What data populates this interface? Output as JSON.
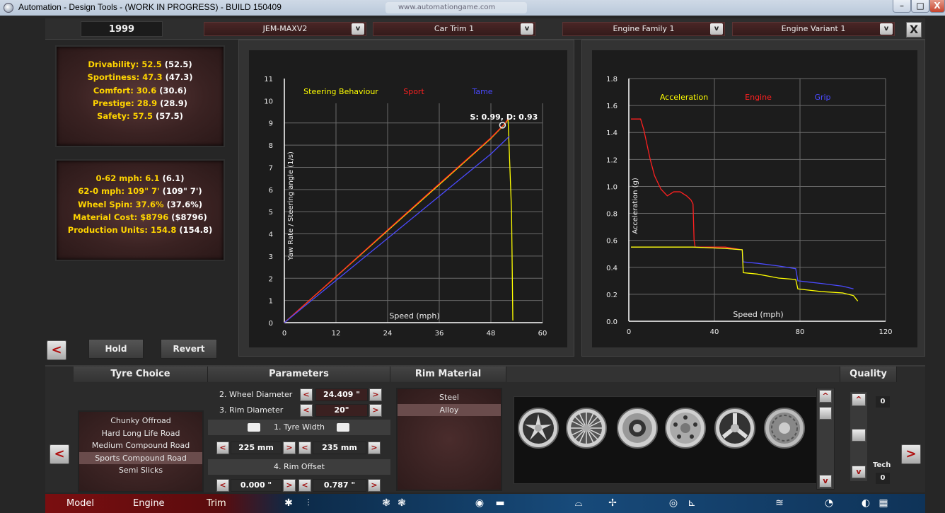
{
  "window": {
    "title": "Automation - Design Tools - (WORK IN PROGRESS) - BUILD 150409",
    "ghost_tab": "www.automationgame.com",
    "min_label": "–",
    "max_label": "□",
    "close_label": "X"
  },
  "topbar": {
    "year": "1999",
    "model": "JEM-MAXV2",
    "trim": "Car Trim 1",
    "engine_family": "Engine Family 1",
    "engine_variant": "Engine Variant 1",
    "arrow": "v",
    "close": "X"
  },
  "stats1": [
    {
      "label": "Drivability: 52.5",
      "paren": "(52.5)"
    },
    {
      "label": "Sportiness: 47.3",
      "paren": "(47.3)"
    },
    {
      "label": "Comfort: 30.6",
      "paren": "(30.6)"
    },
    {
      "label": "Prestige: 28.9",
      "paren": "(28.9)"
    },
    {
      "label": "Safety: 57.5",
      "paren": "(57.5)"
    }
  ],
  "stats2": [
    {
      "label": "0-62 mph: 6.1",
      "paren": "(6.1)"
    },
    {
      "label": "62-0 mph: 109\" 7'",
      "paren": "(109\" 7')"
    },
    {
      "label": "Wheel Spin: 37.6%",
      "paren": "(37.6%)"
    },
    {
      "label": "Material Cost: $8796",
      "paren": "($8796)"
    },
    {
      "label": "Production Units: 154.8",
      "paren": "(154.8)"
    }
  ],
  "buttons": {
    "hold": "Hold",
    "revert": "Revert",
    "prev": "<",
    "next": ">"
  },
  "chart_data": [
    {
      "type": "line",
      "legend": [
        "Steering Behaviour",
        "Sport",
        "Tame"
      ],
      "xlabel": "Speed (mph)",
      "ylabel": "Yaw Rate / Steering angle (1/s)",
      "xlim": [
        0,
        60
      ],
      "ylim": [
        0,
        11
      ],
      "xticks": [
        "0",
        "12",
        "24",
        "36",
        "48",
        "60"
      ],
      "yticks": [
        "0",
        "1",
        "2",
        "3",
        "4",
        "5",
        "6",
        "7",
        "8",
        "9",
        "10",
        "11"
      ],
      "annotation": "S: 0.99, D: 0.93",
      "colors": {
        "steering": "#ffff00",
        "sport": "#ff2020",
        "tame": "#4a4aff"
      },
      "series": [
        {
          "name": "Steering Behaviour",
          "x": [
            0,
            12,
            24,
            36,
            48,
            51,
            52,
            52.8,
            53.1
          ],
          "y": [
            0,
            2.07,
            4.15,
            6.22,
            8.3,
            8.9,
            9.15,
            5.0,
            0.1
          ]
        },
        {
          "name": "Sport",
          "x": [
            0,
            12,
            24,
            36,
            48,
            51,
            52
          ],
          "y": [
            0,
            2.08,
            4.18,
            6.26,
            8.33,
            8.92,
            9.18
          ]
        },
        {
          "name": "Tame",
          "x": [
            0,
            12,
            24,
            36,
            48,
            52.3
          ],
          "y": [
            0,
            1.9,
            3.8,
            5.7,
            7.6,
            8.4
          ]
        }
      ],
      "marker": {
        "x": 50.7,
        "y": 8.9
      }
    },
    {
      "type": "line",
      "legend": [
        "Acceleration",
        "Engine",
        "Grip"
      ],
      "xlabel": "Speed (mph)",
      "ylabel": "Acceleration (g)",
      "xlim": [
        0,
        120
      ],
      "ylim": [
        0,
        1.8
      ],
      "xticks": [
        "0",
        "40",
        "80",
        "120"
      ],
      "yticks": [
        "0.0",
        "0.2",
        "0.4",
        "0.6",
        "0.8",
        "1.0",
        "1.2",
        "1.4",
        "1.6",
        "1.8"
      ],
      "colors": {
        "acceleration": "#ffff00",
        "engine": "#ff2020",
        "grip": "#4a4aff"
      },
      "series": [
        {
          "name": "Engine",
          "x": [
            1,
            5.5,
            7,
            10,
            12,
            15,
            18,
            21,
            24,
            27,
            29,
            30,
            30.5,
            31,
            36,
            45,
            53
          ],
          "y": [
            1.5,
            1.5,
            1.42,
            1.2,
            1.08,
            0.98,
            0.93,
            0.96,
            0.96,
            0.93,
            0.9,
            0.87,
            0.6,
            0.55,
            0.55,
            0.55,
            0.53
          ]
        },
        {
          "name": "Grip",
          "x": [
            1,
            30,
            45,
            53,
            53.5,
            60,
            70,
            78,
            79,
            90,
            100,
            105
          ],
          "y": [
            0.55,
            0.55,
            0.54,
            0.53,
            0.44,
            0.43,
            0.41,
            0.39,
            0.3,
            0.28,
            0.26,
            0.24
          ]
        },
        {
          "name": "Acceleration",
          "x": [
            1,
            30,
            45,
            53,
            53.5,
            60,
            70,
            78,
            79,
            90,
            100,
            105,
            107
          ],
          "y": [
            0.55,
            0.55,
            0.54,
            0.53,
            0.36,
            0.35,
            0.32,
            0.31,
            0.24,
            0.22,
            0.21,
            0.19,
            0.15
          ]
        }
      ]
    }
  ],
  "bottom": {
    "tyre_choice": "Tyre Choice",
    "parameters": "Parameters",
    "rim_material": "Rim Material",
    "quality": "Quality",
    "tyres": [
      "Chunky Offroad",
      "Hard Long Life Road",
      "Medium Compound Road",
      "Sports Compound Road",
      "Semi Slicks"
    ],
    "selected_tyre": "Sports Compound Road",
    "wheel_diameter_label": "2. Wheel Diameter",
    "wheel_diameter": "24.409 \"",
    "rim_diameter_label": "3. Rim Diameter",
    "rim_diameter": "20\"",
    "tyre_width_label": "1. Tyre Width",
    "tyre_width_front": "225 mm",
    "tyre_width_rear": "235 mm",
    "rim_offset_label": "4. Rim Offset",
    "rim_offset_front": "0.000 \"",
    "rim_offset_rear": "0.787 \"",
    "rims": [
      "Steel",
      "Alloy"
    ],
    "selected_rim": "Alloy",
    "quality_value": "0",
    "tech_label": "Tech",
    "tech_value": "0",
    "minus": "<",
    "plus": ">",
    "up": "^",
    "down": "v"
  },
  "tabs": {
    "model": "Model",
    "engine": "Engine",
    "trim": "Trim"
  }
}
